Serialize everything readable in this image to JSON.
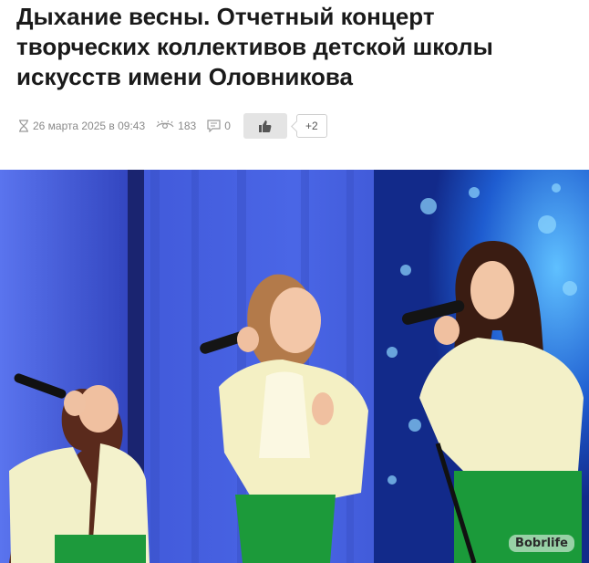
{
  "article": {
    "title": "Дыхание весны. Отчетный концерт творческих коллективов детской школы искусств имени Оловникова",
    "date": "26 марта 2025 в 09:43",
    "views": "183",
    "comments": "0",
    "like_count": "+2"
  },
  "photo": {
    "watermark": "Bobrlife"
  },
  "icons": [
    "hourglass-icon",
    "eye-icon",
    "comment-icon",
    "thumbs-up-icon"
  ],
  "colors": {
    "text": "#1a1a1a",
    "meta": "#8a8a8a",
    "like_bg": "#e4e4e4"
  }
}
